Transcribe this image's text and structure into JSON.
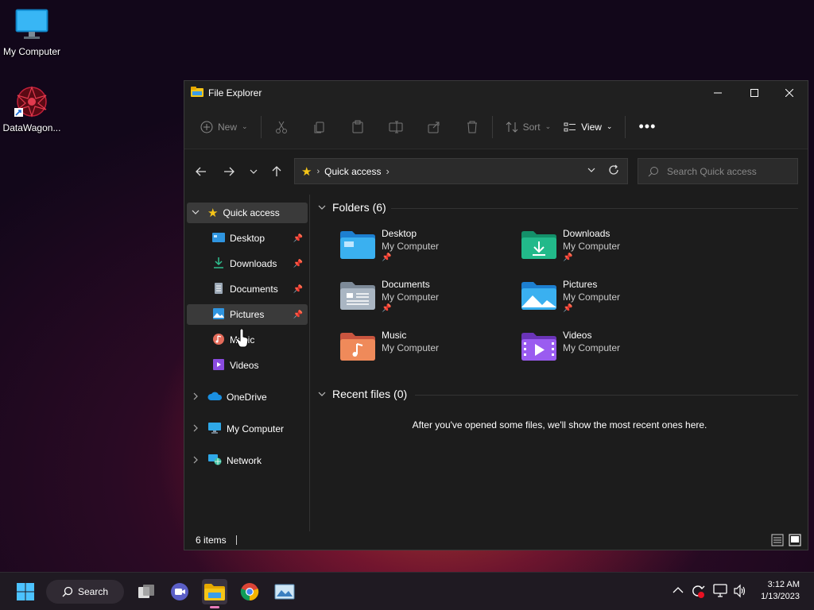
{
  "desktop": {
    "icons": [
      {
        "label": "My Computer"
      },
      {
        "label": "DataWagon..."
      }
    ]
  },
  "window": {
    "title": "File Explorer",
    "toolbar": {
      "new_label": "New",
      "sort_label": "Sort",
      "view_label": "View"
    },
    "address": {
      "location": "Quick access",
      "search_placeholder": "Search Quick access"
    },
    "sidebar": {
      "quick_access": "Quick access",
      "pinned": [
        {
          "label": "Desktop"
        },
        {
          "label": "Downloads"
        },
        {
          "label": "Documents"
        },
        {
          "label": "Pictures"
        },
        {
          "label": "Music"
        },
        {
          "label": "Videos"
        }
      ],
      "roots": [
        {
          "label": "OneDrive"
        },
        {
          "label": "My Computer"
        },
        {
          "label": "Network"
        }
      ]
    },
    "content": {
      "folders_heading": "Folders (6)",
      "folders": [
        {
          "name": "Desktop",
          "location": "My Computer",
          "pinned": true
        },
        {
          "name": "Downloads",
          "location": "My Computer",
          "pinned": true
        },
        {
          "name": "Documents",
          "location": "My Computer",
          "pinned": true
        },
        {
          "name": "Pictures",
          "location": "My Computer",
          "pinned": true
        },
        {
          "name": "Music",
          "location": "My Computer",
          "pinned": false
        },
        {
          "name": "Videos",
          "location": "My Computer",
          "pinned": false
        }
      ],
      "recent_heading": "Recent files (0)",
      "recent_empty": "After you've opened some files, we'll show the most recent ones here."
    },
    "status": {
      "item_count": "6 items"
    }
  },
  "taskbar": {
    "search_label": "Search",
    "time": "3:12 AM",
    "date": "1/13/2023"
  },
  "colors": {
    "accent": "#4cc2ff",
    "window_bg": "#1c1c1c",
    "folder_yellow": "#f5c518"
  }
}
